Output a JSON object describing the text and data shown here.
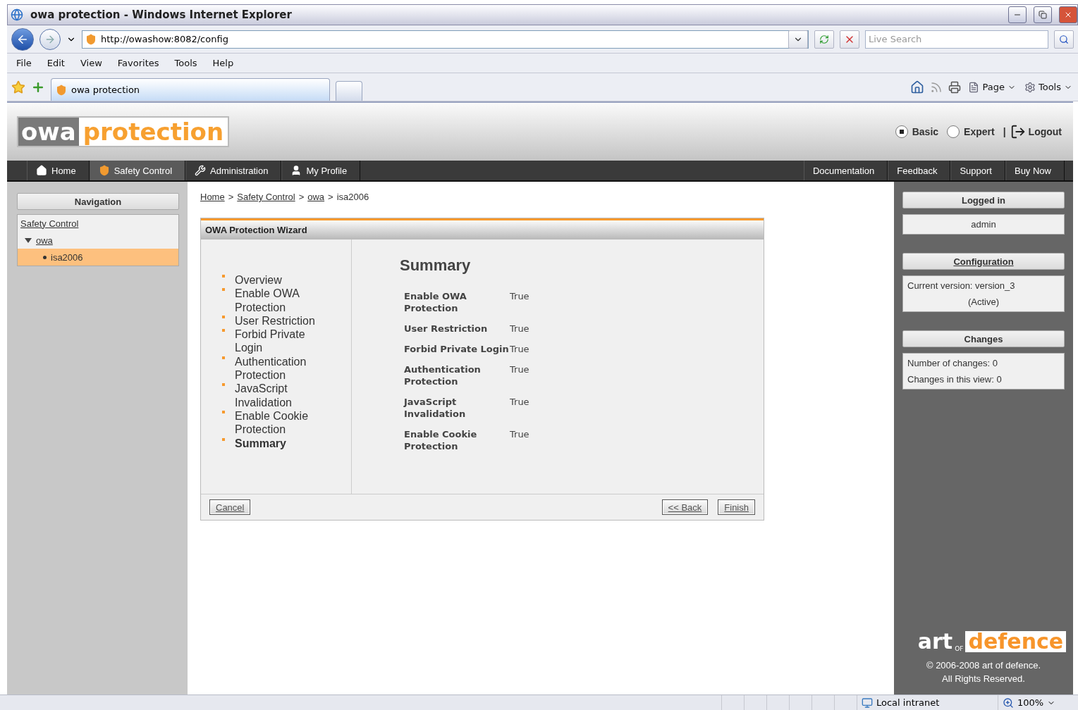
{
  "window": {
    "title": "owa protection - Windows Internet Explorer"
  },
  "browser": {
    "address": "http://owashow:8082/config",
    "search_placeholder": "Live Search",
    "menu": [
      "File",
      "Edit",
      "View",
      "Favorites",
      "Tools",
      "Help"
    ],
    "tabs": [
      {
        "label": "owa protection",
        "selected": true
      }
    ],
    "commands": [
      {
        "kind": "page",
        "label": "Page"
      },
      {
        "kind": "tools",
        "label": "Tools"
      }
    ]
  },
  "header": {
    "logo": [
      "owa",
      "protection"
    ],
    "modes": [
      {
        "label": "Basic",
        "selected": true
      },
      {
        "label": "Expert",
        "selected": false
      }
    ],
    "separator": "|",
    "logout": "Logout"
  },
  "nav": {
    "left": [
      {
        "kind": "home",
        "label": "Home",
        "selected": false
      },
      {
        "kind": "shield",
        "label": "Safety Control",
        "selected": true
      },
      {
        "kind": "tools",
        "label": "Administration",
        "selected": false
      },
      {
        "kind": "user",
        "label": "My Profile",
        "selected": false
      }
    ],
    "right": [
      "Documentation",
      "Feedback",
      "Support",
      "Buy Now"
    ]
  },
  "sidebar": {
    "title": "Navigation",
    "tree": [
      {
        "label": "Safety Control",
        "selected": false,
        "children": [
          {
            "label": "owa",
            "expanded": true,
            "selected": false,
            "children": [
              {
                "label": "isa2006",
                "selected": true
              }
            ]
          }
        ]
      }
    ]
  },
  "breadcrumb": {
    "separator": ">",
    "items": [
      {
        "label": "Home",
        "link": true
      },
      {
        "label": "Safety Control",
        "link": true
      },
      {
        "label": "owa",
        "link": true
      },
      {
        "label": "isa2006",
        "link": false
      }
    ]
  },
  "wizard": {
    "title": "OWA Protection Wizard",
    "steps": [
      {
        "label": "Overview",
        "selected": false
      },
      {
        "label": "Enable OWA Protection",
        "selected": false
      },
      {
        "label": "User Restriction",
        "selected": false
      },
      {
        "label": "Forbid Private Login",
        "selected": false
      },
      {
        "label": "Authentication Protection",
        "selected": false
      },
      {
        "label": "JavaScript Invalidation",
        "selected": false
      },
      {
        "label": "Enable Cookie Protection",
        "selected": false
      },
      {
        "label": "Summary",
        "selected": true
      }
    ],
    "heading": "Summary",
    "rows": [
      {
        "label": "Enable OWA Protection",
        "value": "True"
      },
      {
        "label": "User Restriction",
        "value": "True"
      },
      {
        "label": "Forbid Private Login",
        "value": "True"
      },
      {
        "label": "Authentication Protection",
        "value": "True"
      },
      {
        "label": "JavaScript Invalidation",
        "value": "True"
      },
      {
        "label": "Enable Cookie Protection",
        "value": "True"
      }
    ],
    "cancel": "Cancel",
    "back": "<< Back",
    "finish": "Finish"
  },
  "right_panel": {
    "logged_in": {
      "title": "Logged in",
      "user": "admin"
    },
    "configuration": {
      "title": "Configuration",
      "lines": [
        "Current version: version_3",
        "(Active)"
      ]
    },
    "changes": {
      "title": "Changes",
      "lines": [
        "Number of changes: 0",
        "Changes in this view: 0"
      ]
    },
    "footer": {
      "logo": [
        "art",
        "OF",
        "defence"
      ],
      "copyright": [
        "© 2006-2008 art of defence.",
        "All Rights Reserved."
      ]
    }
  },
  "status_bar": {
    "zone": "Local intranet",
    "zoom": "100%"
  }
}
